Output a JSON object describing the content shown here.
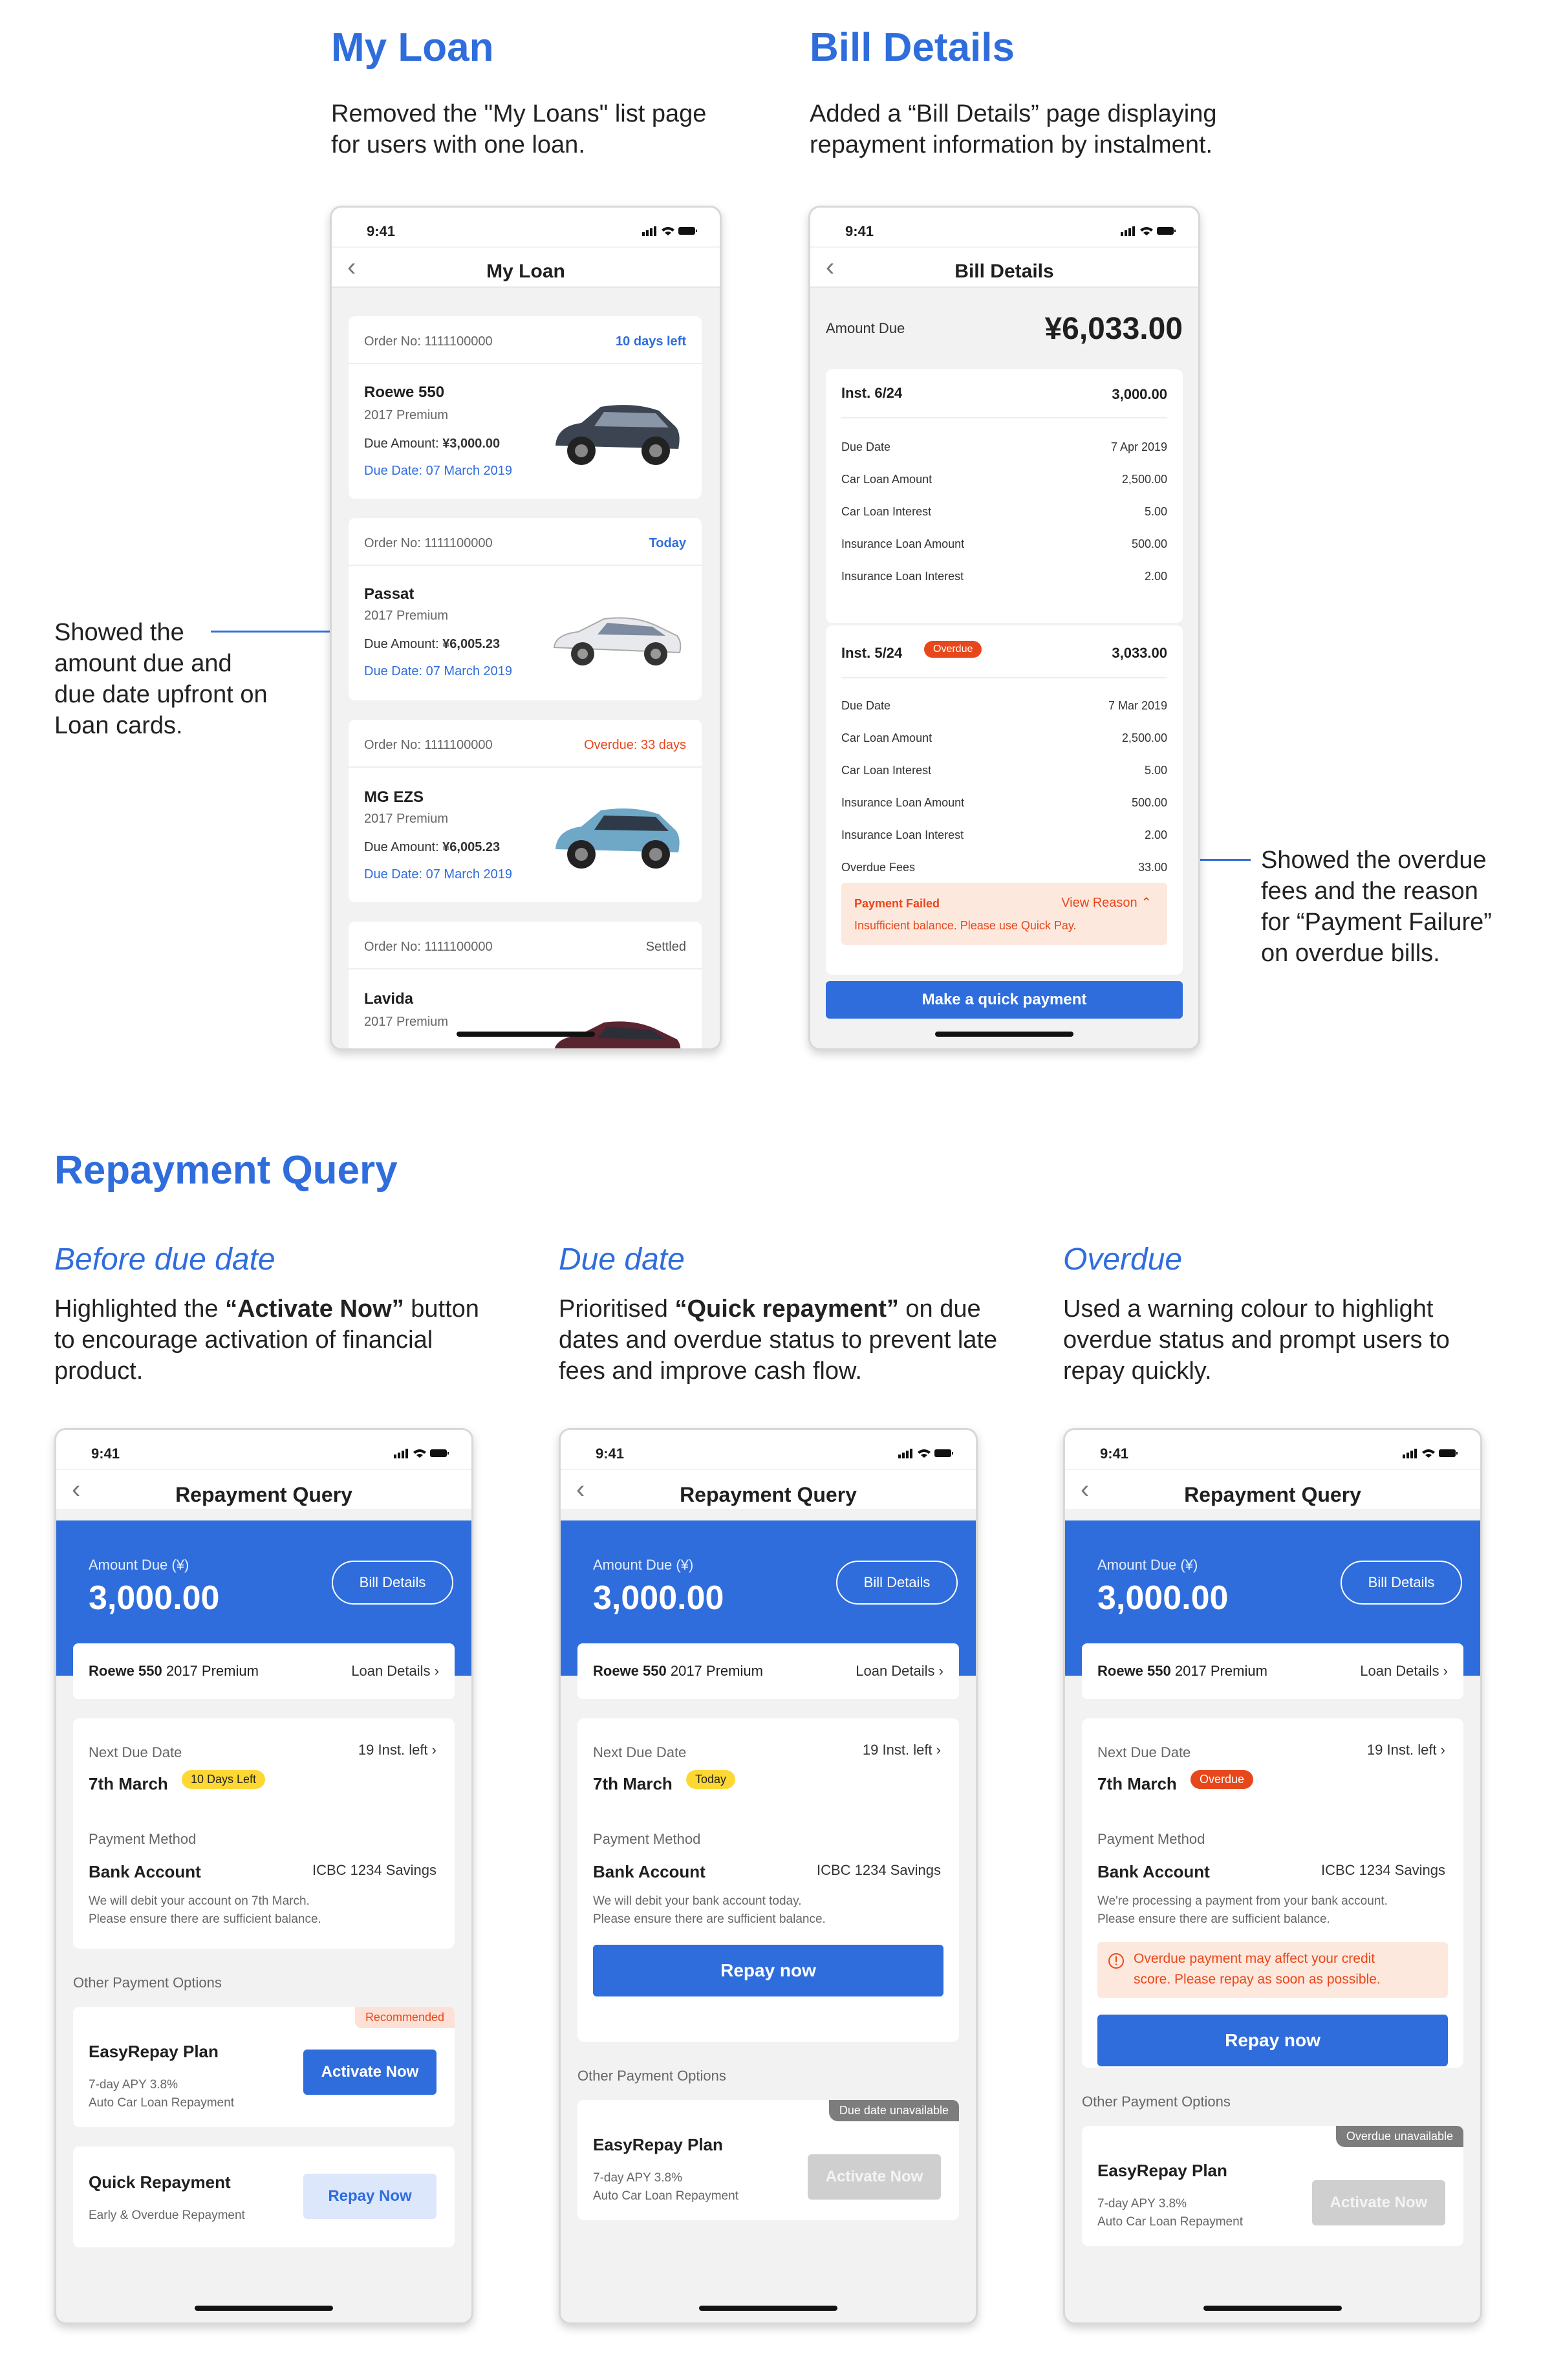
{
  "sections": {
    "my_loan": {
      "title": "My Loan",
      "desc": "Removed the \"My Loans\" list page for users with one loan."
    },
    "bill_details": {
      "title": "Bill Details",
      "desc": "Added a “Bill Details” page displaying repayment information by instalment."
    },
    "repayment_query": {
      "title": "Repayment Query"
    },
    "before": {
      "subtitle": "Before due date",
      "desc_pre": "Highlighted the ",
      "desc_bold": "“Activate Now”",
      "desc_post": " button to encourage activation of financial product."
    },
    "due": {
      "subtitle": "Due date",
      "desc_pre": "Prioritised ",
      "desc_bold": "“Quick repayment”",
      "desc_post": " on due dates and overdue status to prevent late fees and improve cash flow."
    },
    "overdue": {
      "subtitle": "Overdue",
      "desc": "Used a warning colour to highlight overdue status and prompt users to repay quickly."
    }
  },
  "callouts": {
    "loan_cards": "Showed the amount due and due date upfront on Loan cards.",
    "overdue_fees": "Showed the overdue fees and the reason for “Payment Failure” on overdue bills."
  },
  "status_time": "9:41",
  "my_loan_screen": {
    "title": "My Loan",
    "cards": [
      {
        "order": "Order No: 1111100000",
        "status": "10 days left",
        "name": "Roewe 550",
        "trim": "2017 Premium",
        "due_label": "Due Amount:",
        "due_amount": "¥3,000.00",
        "due_date": "Due Date: 07 March 2019"
      },
      {
        "order": "Order No: 1111100000",
        "status": "Today",
        "name": "Passat",
        "trim": "2017 Premium",
        "due_label": "Due Amount:",
        "due_amount": "¥6,005.23",
        "due_date": "Due Date: 07 March 2019"
      },
      {
        "order": "Order No: 1111100000",
        "status": "Overdue: 33 days",
        "name": "MG EZS",
        "trim": "2017 Premium",
        "due_label": "Due Amount:",
        "due_amount": "¥6,005.23",
        "due_date": "Due Date: 07 March 2019"
      },
      {
        "order": "Order No: 1111100000",
        "status": "Settled",
        "name": "Lavida",
        "trim": "2017 Premium"
      }
    ]
  },
  "bill_screen": {
    "title": "Bill Details",
    "amount_label": "Amount Due",
    "amount": "¥6,033.00",
    "inst6": {
      "label": "Inst. 6/24",
      "total": "3,000.00",
      "rows": [
        [
          "Due Date",
          "7 Apr 2019"
        ],
        [
          "Car Loan Amount",
          "2,500.00"
        ],
        [
          "Car Loan Interest",
          "5.00"
        ],
        [
          "Insurance Loan Amount",
          "500.00"
        ],
        [
          "Insurance Loan Interest",
          "2.00"
        ]
      ]
    },
    "inst5": {
      "label": "Inst. 5/24",
      "badge": "Overdue",
      "total": "3,033.00",
      "rows": [
        [
          "Due Date",
          "7 Mar 2019"
        ],
        [
          "Car Loan Amount",
          "2,500.00"
        ],
        [
          "Car Loan Interest",
          "5.00"
        ],
        [
          "Insurance Loan Amount",
          "500.00"
        ],
        [
          "Insurance Loan Interest",
          "2.00"
        ],
        [
          "Overdue Fees",
          "33.00"
        ]
      ]
    },
    "fail_title": "Payment Failed",
    "fail_link": "View Reason",
    "fail_msg": "Insufficient balance. Please use Quick Pay.",
    "button": "Make a quick payment"
  },
  "rq_common": {
    "title": "Repayment Query",
    "amount_label": "Amount Due (¥)",
    "amount": "3,000.00",
    "bill_btn": "Bill Details",
    "car_bold": "Roewe 550",
    "car_trim": " 2017 Premium",
    "loan_details": "Loan Details",
    "next_due": "Next Due Date",
    "inst_left": "19 Inst. left",
    "date": "7th March",
    "pay_method": "Payment Method",
    "bank": "Bank Account",
    "bank_acct": "ICBC 1234 Savings",
    "other": "Other Payment Options",
    "easy": "EasyRepay Plan",
    "apy": "7-day APY 3.8%",
    "auto": "Auto Car Loan Repayment",
    "activate": "Activate Now",
    "repay_now": "Repay now"
  },
  "rq1": {
    "badge": "10 Days Left",
    "note1": "We will debit your account on 7th March.",
    "note2": "Please ensure there are sufficient balance.",
    "recommended": "Recommended",
    "quick": "Quick Repayment",
    "quick_sub": "Early & Overdue Repayment",
    "quick_btn": "Repay Now"
  },
  "rq2": {
    "badge": "Today",
    "note1": "We will debit your bank account today.",
    "note2": "Please ensure there are sufficient balance.",
    "unavail": "Due date unavailable"
  },
  "rq3": {
    "badge": "Overdue",
    "note1": "We're processing a payment from your bank account.",
    "note2": "Please ensure there are sufficient balance.",
    "warn1": "Overdue payment may affect your credit",
    "warn2": "score. Please repay as soon as possible.",
    "unavail": "Overdue unavailable"
  },
  "colors": {
    "accent": "#2f6ddc",
    "warning": "#e8471b",
    "badge_yellow": "#fdd835"
  }
}
